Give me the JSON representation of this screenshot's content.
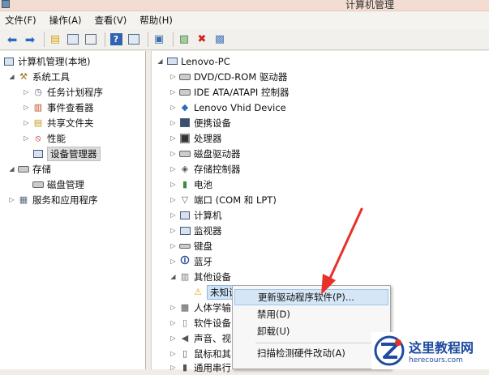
{
  "window": {
    "title": "计算机管理"
  },
  "menu": [
    "文件(F)",
    "操作(A)",
    "查看(V)",
    "帮助(H)"
  ],
  "left_tree": {
    "root": "计算机管理(本地)",
    "system_tools": "系统工具",
    "task_scheduler": "任务计划程序",
    "event_viewer": "事件查看器",
    "shared_folders": "共享文件夹",
    "performance": "性能",
    "device_manager": "设备管理器",
    "storage": "存储",
    "disk_management": "磁盘管理",
    "services_apps": "服务和应用程序"
  },
  "right_tree": {
    "computer": "Lenovo-PC",
    "categories": [
      "DVD/CD-ROM 驱动器",
      "IDE ATA/ATAPI 控制器",
      "Lenovo Vhid Device",
      "便携设备",
      "处理器",
      "磁盘驱动器",
      "存储控制器",
      "电池",
      "端口 (COM 和 LPT)",
      "计算机",
      "监视器",
      "键盘",
      "蓝牙",
      "其他设备",
      "未知设备",
      "人体学输",
      "软件设备",
      "声音、视",
      "鼠标和其",
      "通用串行"
    ]
  },
  "context_menu": {
    "update_driver": "更新驱动程序软件(P)...",
    "disable": "禁用(D)",
    "uninstall": "卸载(U)",
    "scan": "扫描检测硬件改动(A)"
  },
  "watermark": {
    "cn": "这里教程网",
    "en": "herecours.com"
  },
  "colors": {
    "highlight": "#d5e6f7",
    "arrow": "#e8312a",
    "brand": "#1f4ba0"
  }
}
